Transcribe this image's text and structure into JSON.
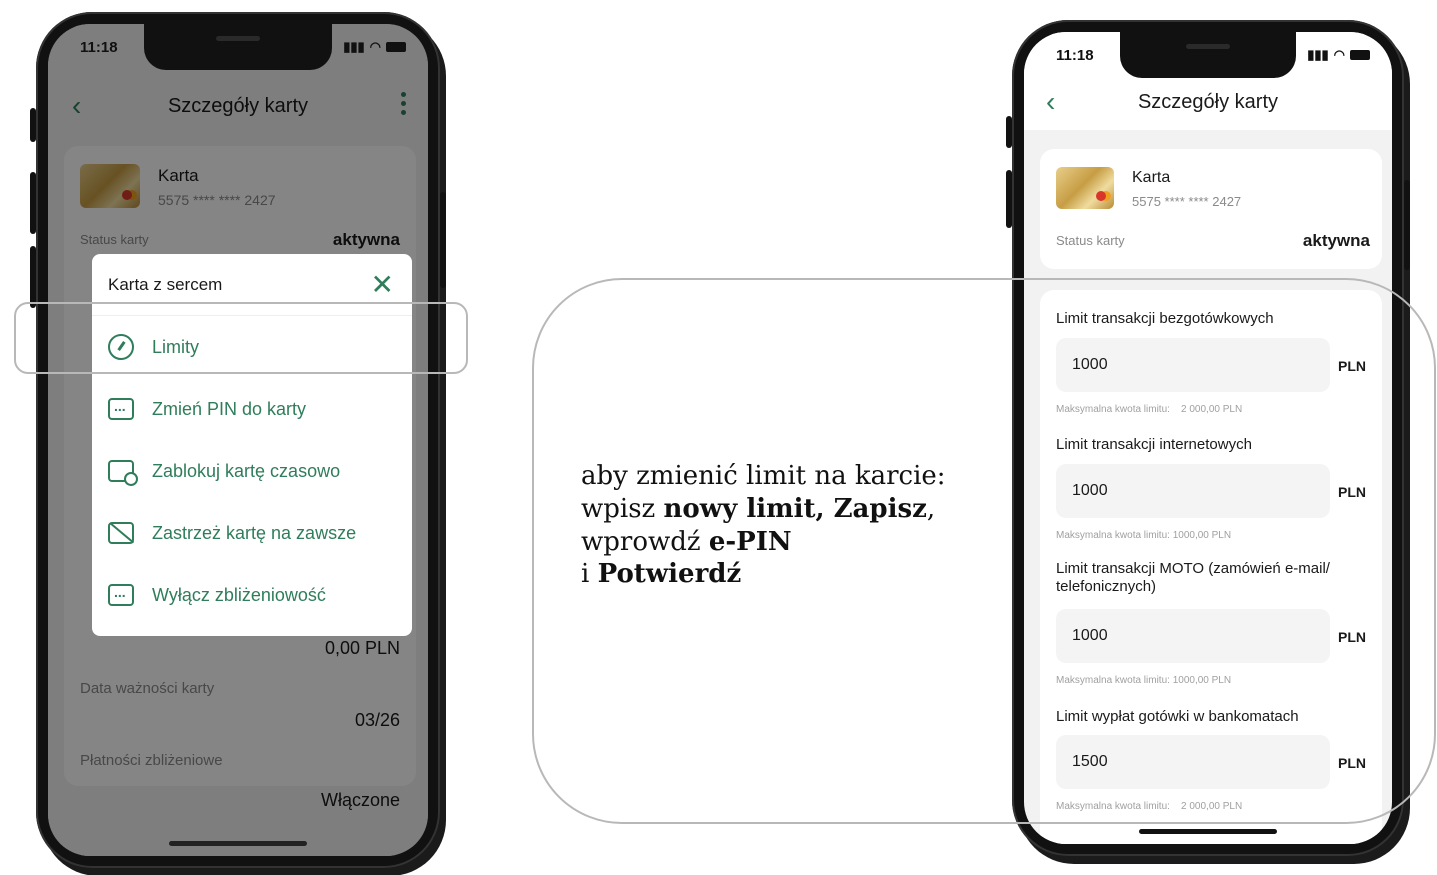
{
  "status_time": "11:18",
  "left_phone": {
    "header_title": "Szczegóły karty",
    "card_name": "Karta",
    "card_number": "5575 **** **** 2427",
    "status_label": "Status karty",
    "status_value": "aktywna",
    "amount_value": "0,00 PLN",
    "expiry_label": "Data ważności karty",
    "expiry_value": "03/26",
    "contactless_label": "Płatności zbliżeniowe",
    "contactless_value": "Włączone",
    "sheet": {
      "title": "Karta z sercem",
      "items": [
        {
          "label": "Limity",
          "icon": "gauge-icon"
        },
        {
          "label": "Zmień PIN do karty",
          "icon": "pin-icon"
        },
        {
          "label": "Zablokuj kartę czasowo",
          "icon": "block-icon"
        },
        {
          "label": "Zastrzeż kartę na zawsze",
          "icon": "cancel-card-icon"
        },
        {
          "label": "Wyłącz zbliżeniowość",
          "icon": "contactless-icon"
        }
      ]
    }
  },
  "instruction": {
    "line1": "aby zmienić limit na karcie:",
    "line2_a": "wpisz ",
    "line2_b": "nowy limit, Zapisz",
    "line2_c": ",",
    "line3_a": "wprowdź ",
    "line3_b": "e-PIN",
    "line4_a": "i ",
    "line4_b": "Potwierdź"
  },
  "right_phone": {
    "header_title": "Szczegóły karty",
    "card_name": "Karta",
    "card_number": "5575 **** **** 2427",
    "status_label": "Status karty",
    "status_value": "aktywna",
    "limits": [
      {
        "label": "Limit transakcji bezgotówkowych",
        "value": "1000",
        "unit": "PLN",
        "hint": "Maksymalna kwota limitu:    2 000,00 PLN"
      },
      {
        "label": "Limit transakcji internetowych",
        "value": "1000",
        "unit": "PLN",
        "hint": "Maksymalna kwota limitu: 1000,00 PLN"
      },
      {
        "label": "Limit transakcji MOTO (zamówień e-mail/ telefonicznych)",
        "value": "1000",
        "unit": "PLN",
        "hint": "Maksymalna kwota limitu: 1000,00 PLN"
      },
      {
        "label": "Limit wypłat gotówki w bankomatach",
        "value": "1500",
        "unit": "PLN",
        "hint": "Maksymalna kwota limitu:    2 000,00 PLN"
      }
    ]
  }
}
